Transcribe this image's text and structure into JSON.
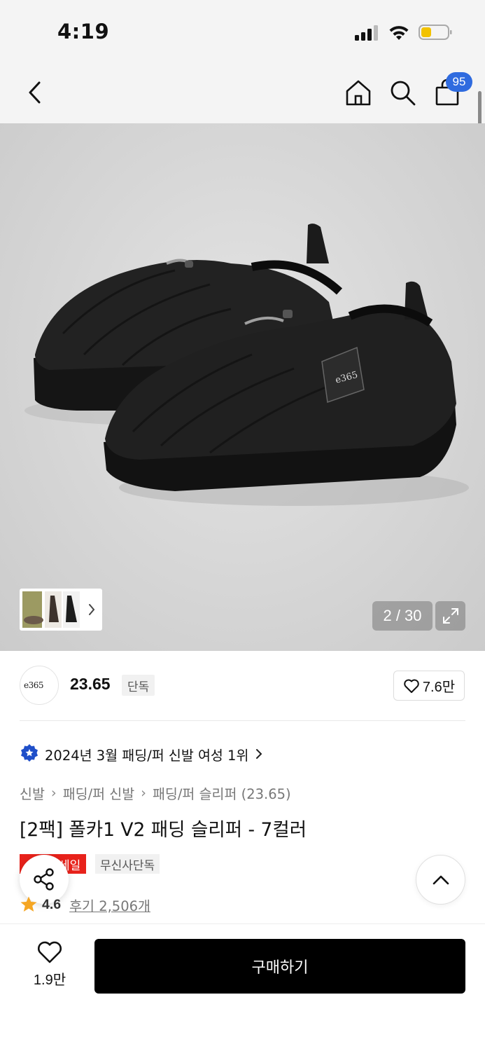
{
  "status_bar": {
    "time": "4:19"
  },
  "nav": {
    "cart_count": "95"
  },
  "gallery": {
    "counter": "2 / 30"
  },
  "brand": {
    "name": "23.65",
    "tag": "단독",
    "likes": "7.6만"
  },
  "ranking": {
    "text": "2024년 3월 패딩/퍼 신발 여성 1위"
  },
  "breadcrumb": {
    "items": [
      "신발",
      "패딩/퍼 신발",
      "패딩/퍼 슬리퍼 (23.65)"
    ]
  },
  "product": {
    "title": "[2팩] 폴카1 V2 패딩 슬리퍼 - 7컬러",
    "badge_sale_partial": "세일",
    "badge_exclusive": "무신사단독",
    "rating": "4.6",
    "reviews": "후기 2,506개"
  },
  "bottom": {
    "like_count": "1.9만",
    "buy_label": "구매하기"
  },
  "colors": {
    "cart_badge": "#2f6bdf",
    "sale_badge": "#e8221b",
    "star": "#f5a623",
    "buy_button": "#000000"
  }
}
